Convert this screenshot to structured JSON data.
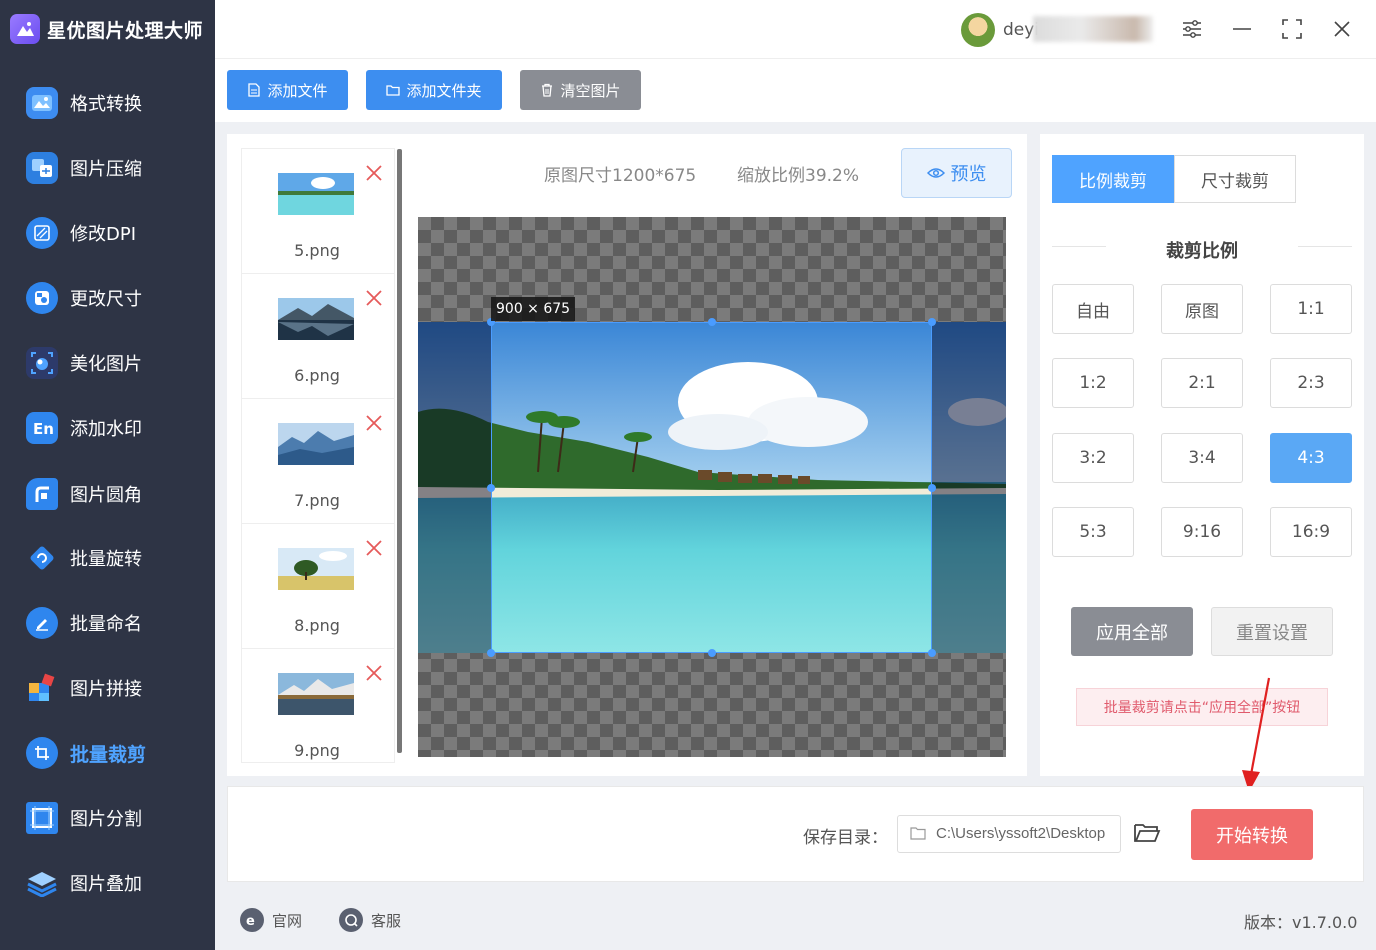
{
  "app": {
    "title": "星优图片处理大师"
  },
  "titlebar": {
    "username": "deyi22."
  },
  "sidebar": {
    "items": [
      {
        "label": "格式转换",
        "icon": "image-convert-icon"
      },
      {
        "label": "图片压缩",
        "icon": "compress-icon"
      },
      {
        "label": "修改DPI",
        "icon": "dpi-icon"
      },
      {
        "label": "更改尺寸",
        "icon": "resize-icon"
      },
      {
        "label": "美化图片",
        "icon": "beautify-icon"
      },
      {
        "label": "添加水印",
        "icon": "watermark-icon"
      },
      {
        "label": "图片圆角",
        "icon": "rounded-corner-icon"
      },
      {
        "label": "批量旋转",
        "icon": "rotate-icon"
      },
      {
        "label": "批量命名",
        "icon": "rename-icon"
      },
      {
        "label": "图片拼接",
        "icon": "puzzle-icon"
      },
      {
        "label": "批量裁剪",
        "icon": "crop-icon",
        "active": true
      },
      {
        "label": "图片分割",
        "icon": "split-icon"
      },
      {
        "label": "图片叠加",
        "icon": "layers-icon"
      }
    ]
  },
  "toolbar": {
    "add_file": "添加文件",
    "add_folder": "添加文件夹",
    "clear": "清空图片"
  },
  "files": [
    {
      "name": "5.png"
    },
    {
      "name": "6.png"
    },
    {
      "name": "7.png"
    },
    {
      "name": "8.png"
    },
    {
      "name": "9.png"
    }
  ],
  "preview": {
    "original_size": "原图尺寸1200*675",
    "zoom": "缩放比例39.2%",
    "preview_label": "预览",
    "crop_size": "900 × 675"
  },
  "crop": {
    "tabs": [
      "比例裁剪",
      "尺寸裁剪"
    ],
    "section_title": "裁剪比例",
    "ratios": [
      "自由",
      "原图",
      "1:1",
      "1:2",
      "2:1",
      "2:3",
      "3:2",
      "3:4",
      "4:3",
      "5:3",
      "9:16",
      "16:9"
    ],
    "selected_ratio": "4:3",
    "apply_all": "应用全部",
    "reset": "重置设置",
    "hint": "批量裁剪请点击“应用全部”按钮"
  },
  "output": {
    "save_label": "保存目录：",
    "path": "C:\\Users\\yssoft2\\Desktop",
    "start": "开始转换"
  },
  "footer": {
    "website": "官网",
    "support": "客服",
    "version": "版本：v1.7.0.0"
  },
  "colors": {
    "accent": "#4fa3ff",
    "sidebar": "#2e3445",
    "start": "#f16b6b"
  }
}
